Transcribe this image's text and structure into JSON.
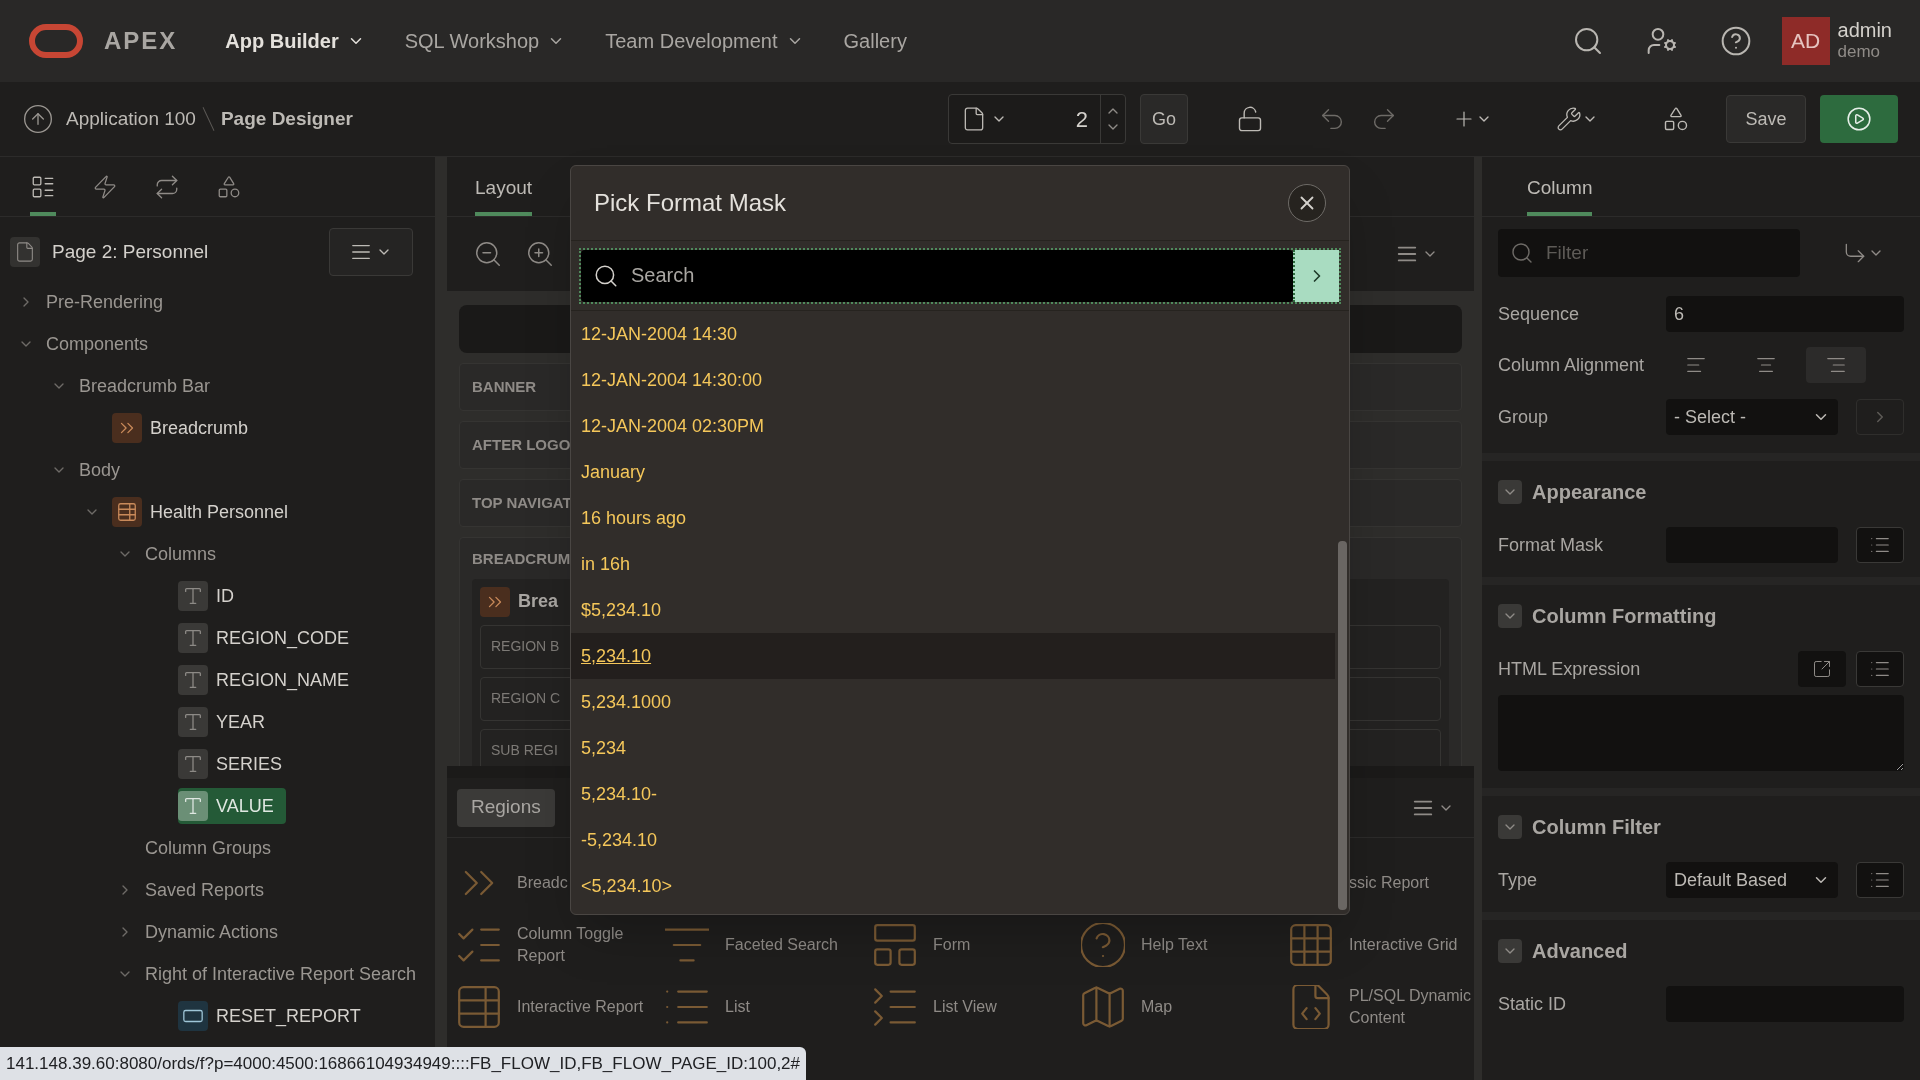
{
  "topnav": {
    "logo": "APEX",
    "menus": [
      {
        "label": "App Builder",
        "selected": true,
        "caret": true
      },
      {
        "label": "SQL Workshop",
        "selected": false,
        "caret": true
      },
      {
        "label": "Team Development",
        "selected": false,
        "caret": true
      },
      {
        "label": "Gallery",
        "selected": false,
        "caret": false
      }
    ],
    "user": {
      "initials": "AD",
      "name": "admin",
      "workspace": "demo"
    }
  },
  "toolbar": {
    "breadcrumb": [
      "Application 100",
      "Page Designer"
    ],
    "page_number": "2",
    "go": "Go",
    "save": "Save"
  },
  "left_panel": {
    "tabs": [
      {
        "kind": "tree",
        "selected": true
      },
      {
        "kind": "dynamic",
        "selected": false
      },
      {
        "kind": "processing",
        "selected": false
      },
      {
        "kind": "shared",
        "selected": false
      }
    ],
    "page": "Page 2: Personnel",
    "tree": [
      {
        "label": "Pre-Rendering",
        "expanded": false
      },
      {
        "label": "Components",
        "expanded": true,
        "children": [
          {
            "label": "Breadcrumb Bar",
            "expanded": true,
            "children": [
              {
                "label": "Breadcrumb",
                "kind": "breadcrumb",
                "selected": false
              }
            ]
          },
          {
            "label": "Body",
            "expanded": true,
            "children": [
              {
                "label": "Health Personnel",
                "kind": "report",
                "expanded": true,
                "children": [
                  {
                    "label": "Columns",
                    "expanded": true,
                    "children": [
                      {
                        "label": "ID",
                        "kind": "column",
                        "selected": false
                      },
                      {
                        "label": "REGION_CODE",
                        "kind": "column",
                        "selected": false
                      },
                      {
                        "label": "REGION_NAME",
                        "kind": "column",
                        "selected": false
                      },
                      {
                        "label": "YEAR",
                        "kind": "column",
                        "selected": false
                      },
                      {
                        "label": "SERIES",
                        "kind": "column",
                        "selected": false
                      },
                      {
                        "label": "VALUE",
                        "kind": "column",
                        "selected": true
                      }
                    ]
                  },
                  {
                    "label": "Column Groups"
                  },
                  {
                    "label": "Saved Reports",
                    "expanded": false
                  },
                  {
                    "label": "Dynamic Actions",
                    "expanded": false
                  },
                  {
                    "label": "Right of Interactive Report Search",
                    "expanded": true,
                    "children": [
                      {
                        "label": "RESET_REPORT",
                        "kind": "button",
                        "selected": false
                      }
                    ]
                  }
                ]
              }
            ]
          }
        ]
      }
    ]
  },
  "layout": {
    "tab": "Layout",
    "positions": [
      "BANNER",
      "AFTER LOGO",
      "TOP NAVIGAT",
      "BREADCRUM"
    ],
    "breadcrumb_region": "Brea",
    "sub_positions": [
      "REGION B",
      "REGION C",
      "SUB REGI"
    ]
  },
  "gallery": {
    "tab": "Regions",
    "items": [
      {
        "kind": "breadcrumb",
        "label": "Breadc"
      },
      {
        "kind": "hidden",
        "label": "ssic Report"
      },
      {
        "kind": "toggle",
        "label": "Column Toggle Report"
      },
      {
        "kind": "faceted",
        "label": "Faceted Search"
      },
      {
        "kind": "form",
        "label": "Form"
      },
      {
        "kind": "help",
        "label": "Help Text"
      },
      {
        "kind": "grid",
        "label": "Interactive Grid"
      },
      {
        "kind": "ireport",
        "label": "Interactive Report"
      },
      {
        "kind": "list",
        "label": "List"
      },
      {
        "kind": "listview",
        "label": "List View"
      },
      {
        "kind": "map",
        "label": "Map"
      },
      {
        "kind": "plsql",
        "label": "PL/SQL Dynamic Content"
      }
    ]
  },
  "dialog": {
    "title": "Pick Format Mask",
    "search": {
      "placeholder": "Search"
    },
    "options": [
      {
        "label": "12-JAN-2004 14:30",
        "selected": false
      },
      {
        "label": "12-JAN-2004 14:30:00",
        "selected": false
      },
      {
        "label": "12-JAN-2004 02:30PM",
        "selected": false
      },
      {
        "label": "January",
        "selected": false
      },
      {
        "label": "16 hours ago",
        "selected": false
      },
      {
        "label": "in 16h",
        "selected": false
      },
      {
        "label": "$5,234.10",
        "selected": false
      },
      {
        "label": "5,234.10",
        "selected": true
      },
      {
        "label": "5,234.1000",
        "selected": false
      },
      {
        "label": "5,234",
        "selected": false
      },
      {
        "label": "5,234.10-",
        "selected": false
      },
      {
        "label": "-5,234.10",
        "selected": false
      },
      {
        "label": "<5,234.10>",
        "selected": false
      }
    ]
  },
  "properties": {
    "tab": "Column",
    "filter": {
      "placeholder": "Filter"
    },
    "sequence": {
      "label": "Sequence",
      "value": "6"
    },
    "alignment": {
      "label": "Column Alignment",
      "options": [
        {
          "kind": "left",
          "selected": false
        },
        {
          "kind": "center",
          "selected": false
        },
        {
          "kind": "right",
          "selected": true
        }
      ]
    },
    "group": {
      "label": "Group",
      "value": "- Select -"
    },
    "sections": [
      {
        "title": "Appearance",
        "expanded": true,
        "fields": [
          {
            "kind": "picker",
            "label": "Format Mask"
          }
        ]
      },
      {
        "title": "Column Formatting",
        "expanded": true,
        "fields": [
          {
            "kind": "code",
            "label": "HTML Expression"
          }
        ]
      },
      {
        "title": "Column Filter",
        "expanded": true,
        "fields": [
          {
            "kind": "select",
            "label": "Type",
            "value": "Default Based"
          }
        ]
      },
      {
        "title": "Advanced",
        "expanded": true,
        "fields": [
          {
            "kind": "text",
            "label": "Static ID"
          }
        ]
      }
    ]
  },
  "status_url": "141.148.39.60:8080/ords/f?p=4000:4500:16866104934949::::FB_FLOW_ID,FB_FLOW_PAGE_ID:100,2#"
}
